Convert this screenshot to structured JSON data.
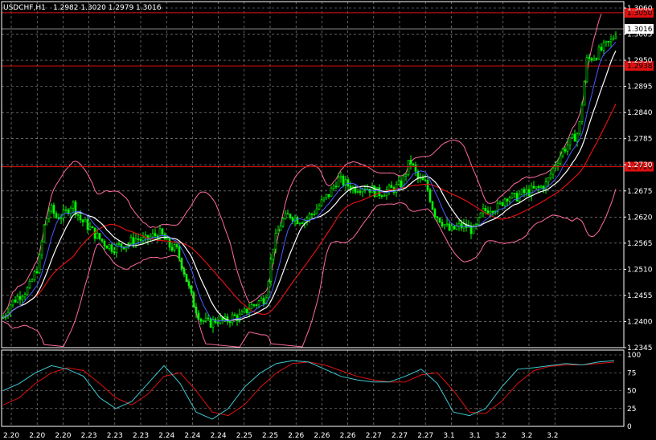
{
  "header": {
    "symbol": "USDCHF,H1",
    "ohlc": "1.2982 1.3020 1.2979 1.3016"
  },
  "colors": {
    "background": "#000000",
    "grid": "#9a9a9a",
    "frame": "#ffffff",
    "candle": "#00ff00",
    "ma_fast": "#4a5cff",
    "ma_mid": "#ffffff",
    "ma_slow": "#e01010",
    "bands": "#ff6aa0",
    "levels": "#e01010",
    "stoch_main": "#40c8d0",
    "stoch_signal": "#e01010"
  },
  "icons": {
    "current_price_marker": "white-price-box",
    "level_marker": "red-price-box"
  },
  "price_axis": {
    "labels": [
      "1.3060",
      "1.3005",
      "1.2950",
      "1.2895",
      "1.2840",
      "1.2785",
      "1.2730",
      "1.2675",
      "1.2620",
      "1.2565",
      "1.2510",
      "1.2455",
      "1.2400",
      "1.2345"
    ]
  },
  "current_price": "1.3016",
  "levels": [
    {
      "label": "1.3050",
      "value": 1.305
    },
    {
      "label": "1.2938",
      "value": 1.2938
    },
    {
      "label": "1.2726",
      "value": 1.2726
    }
  ],
  "osc_axis": {
    "labels": [
      "100",
      "75",
      "50",
      "25",
      "0"
    ]
  },
  "time_axis": {
    "labels": [
      "2.20",
      "2.20",
      "2.20",
      "2.23",
      "2.23",
      "2.23",
      "2.24",
      "2.24",
      "2.24",
      "2.25",
      "2.25",
      "2.26",
      "2.26",
      "2.26",
      "2.27",
      "2.27",
      "2.27",
      "3.1",
      "3.1",
      "3.2",
      "3.2",
      "3.2"
    ]
  },
  "chart_data": {
    "type": "candlestick",
    "symbol": "USDCHF",
    "timeframe": "H1",
    "ylim": [
      1.2345,
      1.306
    ],
    "oscillator": {
      "type": "line",
      "ylim": [
        0,
        100
      ],
      "grid": true
    },
    "grid": true,
    "close_path": [
      [
        0,
        1.2395
      ],
      [
        12,
        1.2435
      ],
      [
        24,
        1.2455
      ],
      [
        36,
        1.247
      ],
      [
        48,
        1.252
      ],
      [
        55,
        1.26
      ],
      [
        62,
        1.264
      ],
      [
        70,
        1.262
      ],
      [
        80,
        1.2625
      ],
      [
        90,
        1.265
      ],
      [
        100,
        1.2615
      ],
      [
        110,
        1.26
      ],
      [
        120,
        1.258
      ],
      [
        130,
        1.2565
      ],
      [
        140,
        1.2555
      ],
      [
        150,
        1.256
      ],
      [
        160,
        1.2565
      ],
      [
        170,
        1.2575
      ],
      [
        180,
        1.257
      ],
      [
        190,
        1.258
      ],
      [
        200,
        1.2585
      ],
      [
        210,
        1.256
      ],
      [
        220,
        1.255
      ],
      [
        230,
        1.25
      ],
      [
        240,
        1.244
      ],
      [
        250,
        1.2405
      ],
      [
        260,
        1.2395
      ],
      [
        270,
        1.2405
      ],
      [
        280,
        1.24
      ],
      [
        290,
        1.241
      ],
      [
        300,
        1.241
      ],
      [
        310,
        1.243
      ],
      [
        320,
        1.244
      ],
      [
        330,
        1.245
      ],
      [
        340,
        1.256
      ],
      [
        350,
        1.261
      ],
      [
        360,
        1.2625
      ],
      [
        370,
        1.2615
      ],
      [
        380,
        1.2615
      ],
      [
        390,
        1.263
      ],
      [
        400,
        1.265
      ],
      [
        410,
        1.267
      ],
      [
        420,
        1.27
      ],
      [
        430,
        1.269
      ],
      [
        440,
        1.268
      ],
      [
        450,
        1.2685
      ],
      [
        460,
        1.268
      ],
      [
        470,
        1.267
      ],
      [
        480,
        1.2675
      ],
      [
        490,
        1.268
      ],
      [
        500,
        1.269
      ],
      [
        510,
        1.274
      ],
      [
        520,
        1.27
      ],
      [
        530,
        1.269
      ],
      [
        540,
        1.263
      ],
      [
        550,
        1.261
      ],
      [
        560,
        1.259
      ],
      [
        570,
        1.26
      ],
      [
        580,
        1.26
      ],
      [
        590,
        1.259
      ],
      [
        600,
        1.263
      ],
      [
        610,
        1.264
      ],
      [
        620,
        1.264
      ],
      [
        630,
        1.2665
      ],
      [
        640,
        1.266
      ],
      [
        650,
        1.267
      ],
      [
        660,
        1.2675
      ],
      [
        670,
        1.268
      ],
      [
        680,
        1.269
      ],
      [
        690,
        1.273
      ],
      [
        700,
        1.276
      ],
      [
        710,
        1.278
      ],
      [
        720,
        1.28
      ],
      [
        730,
        1.295
      ],
      [
        740,
        1.296
      ],
      [
        750,
        1.2975
      ],
      [
        760,
        1.299
      ],
      [
        768,
        1.3016
      ]
    ],
    "stoch_main": [
      [
        0,
        50
      ],
      [
        20,
        60
      ],
      [
        40,
        75
      ],
      [
        60,
        85
      ],
      [
        80,
        80
      ],
      [
        100,
        70
      ],
      [
        120,
        40
      ],
      [
        140,
        25
      ],
      [
        160,
        35
      ],
      [
        180,
        60
      ],
      [
        200,
        85
      ],
      [
        220,
        60
      ],
      [
        240,
        20
      ],
      [
        260,
        10
      ],
      [
        280,
        25
      ],
      [
        300,
        55
      ],
      [
        320,
        75
      ],
      [
        340,
        88
      ],
      [
        360,
        92
      ],
      [
        380,
        90
      ],
      [
        400,
        80
      ],
      [
        420,
        70
      ],
      [
        440,
        65
      ],
      [
        460,
        62
      ],
      [
        480,
        62
      ],
      [
        500,
        70
      ],
      [
        520,
        80
      ],
      [
        540,
        60
      ],
      [
        560,
        20
      ],
      [
        580,
        15
      ],
      [
        600,
        25
      ],
      [
        620,
        55
      ],
      [
        640,
        80
      ],
      [
        660,
        82
      ],
      [
        680,
        85
      ],
      [
        700,
        88
      ],
      [
        720,
        86
      ],
      [
        740,
        90
      ],
      [
        760,
        92
      ]
    ],
    "stoch_signal": [
      [
        0,
        30
      ],
      [
        20,
        40
      ],
      [
        40,
        60
      ],
      [
        60,
        75
      ],
      [
        80,
        82
      ],
      [
        100,
        78
      ],
      [
        120,
        60
      ],
      [
        140,
        40
      ],
      [
        160,
        30
      ],
      [
        180,
        45
      ],
      [
        200,
        70
      ],
      [
        220,
        75
      ],
      [
        240,
        50
      ],
      [
        260,
        20
      ],
      [
        280,
        15
      ],
      [
        300,
        30
      ],
      [
        320,
        55
      ],
      [
        340,
        75
      ],
      [
        360,
        88
      ],
      [
        380,
        90
      ],
      [
        400,
        86
      ],
      [
        420,
        78
      ],
      [
        440,
        70
      ],
      [
        460,
        65
      ],
      [
        480,
        62
      ],
      [
        500,
        62
      ],
      [
        520,
        72
      ],
      [
        540,
        75
      ],
      [
        560,
        50
      ],
      [
        580,
        20
      ],
      [
        600,
        18
      ],
      [
        620,
        35
      ],
      [
        640,
        60
      ],
      [
        660,
        78
      ],
      [
        680,
        84
      ],
      [
        700,
        86
      ],
      [
        720,
        86
      ],
      [
        740,
        88
      ],
      [
        760,
        90
      ]
    ]
  }
}
